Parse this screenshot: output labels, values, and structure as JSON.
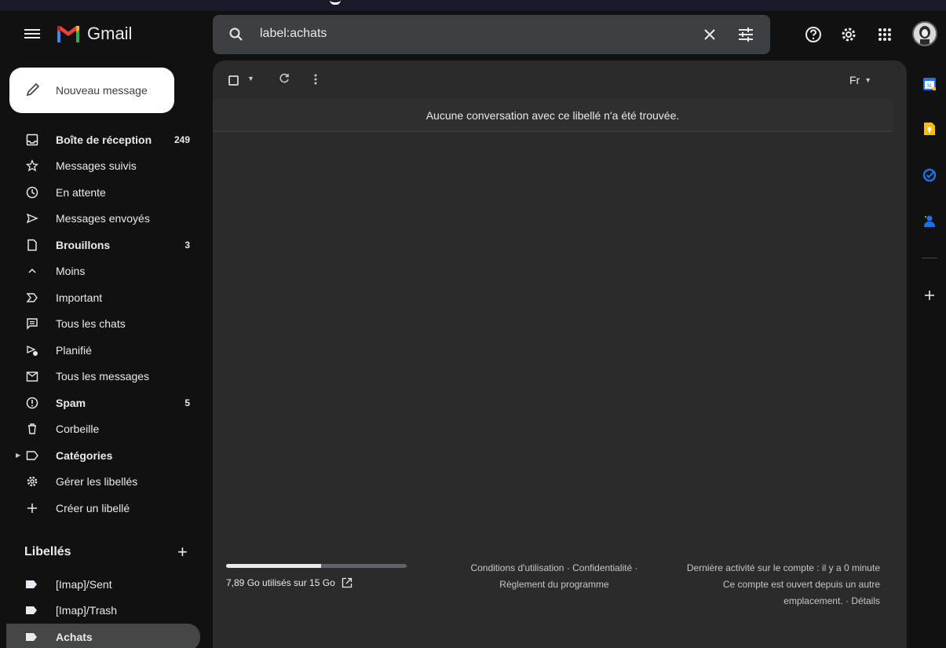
{
  "app": {
    "name": "Gmail"
  },
  "search": {
    "query": "label:achats"
  },
  "compose": {
    "label": "Nouveau message"
  },
  "nav": {
    "items": [
      {
        "label": "Boîte de réception",
        "count": "249",
        "icon": "inbox-icon",
        "bold": true
      },
      {
        "label": "Messages suivis",
        "count": "",
        "icon": "star-icon",
        "bold": false
      },
      {
        "label": "En attente",
        "count": "",
        "icon": "clock-icon",
        "bold": false
      },
      {
        "label": "Messages envoyés",
        "count": "",
        "icon": "send-icon",
        "bold": false
      },
      {
        "label": "Brouillons",
        "count": "3",
        "icon": "draft-icon",
        "bold": true
      },
      {
        "label": "Moins",
        "count": "",
        "icon": "chevron-up-icon",
        "bold": false
      },
      {
        "label": "Important",
        "count": "",
        "icon": "important-icon",
        "bold": false
      },
      {
        "label": "Tous les chats",
        "count": "",
        "icon": "chat-icon",
        "bold": false
      },
      {
        "label": "Planifié",
        "count": "",
        "icon": "scheduled-icon",
        "bold": false
      },
      {
        "label": "Tous les messages",
        "count": "",
        "icon": "all-mail-icon",
        "bold": false
      },
      {
        "label": "Spam",
        "count": "5",
        "icon": "spam-icon",
        "bold": true
      },
      {
        "label": "Corbeille",
        "count": "",
        "icon": "trash-icon",
        "bold": false
      },
      {
        "label": "Catégories",
        "count": "",
        "icon": "label-icon",
        "bold": true
      },
      {
        "label": "Gérer les libellés",
        "count": "",
        "icon": "gear-icon",
        "bold": false
      },
      {
        "label": "Créer un libellé",
        "count": "",
        "icon": "plus-icon",
        "bold": false
      }
    ]
  },
  "labels": {
    "header": "Libellés",
    "items": [
      {
        "label": "[Imap]/Sent",
        "active": false
      },
      {
        "label": "[Imap]/Trash",
        "active": false
      },
      {
        "label": "Achats",
        "active": true
      }
    ]
  },
  "toolbar": {
    "language": "Fr"
  },
  "main": {
    "empty_message": "Aucune conversation avec ce libellé n'a été trouvée."
  },
  "footer": {
    "storage_text": "7,89 Go utilisés sur 15 Go",
    "storage_fraction": 0.526,
    "terms_line1": "Conditions d'utilisation · Confidentialité ·",
    "terms_line2": "Règlement du programme",
    "activity_line1": "Dernière activité sur le compte : il y a 0 minute",
    "activity_line2": "Ce compte est ouvert depuis un autre",
    "activity_line3": "emplacement. · Détails"
  },
  "colors": {
    "background": "#111111",
    "panel": "#2b2b2b",
    "search": "#3c4043",
    "active_label": "#444746"
  }
}
